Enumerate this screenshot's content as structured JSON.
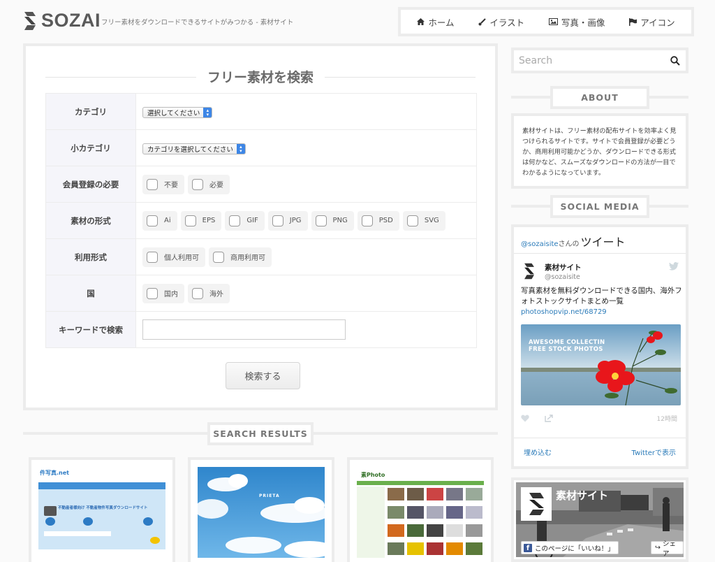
{
  "header": {
    "logo_text": "SOZAI",
    "tagline": "フリー素材をダウンロードできるサイトがみつかる - 素材サイト",
    "nav": [
      {
        "label": "ホーム",
        "icon": "home-icon"
      },
      {
        "label": "イラスト",
        "icon": "brush-icon"
      },
      {
        "label": "写真・画像",
        "icon": "picture-icon"
      },
      {
        "label": "アイコン",
        "icon": "flag-icon"
      }
    ]
  },
  "search_panel": {
    "title": "フリー素材を検索",
    "rows": {
      "category": {
        "label": "カテゴリ",
        "select": "選択してください"
      },
      "subcategory": {
        "label": "小カテゴリ",
        "select": "カテゴリを選択してください"
      },
      "registration": {
        "label": "会員登録の必要",
        "options": [
          "不要",
          "必要"
        ]
      },
      "format": {
        "label": "素材の形式",
        "options": [
          "Ai",
          "EPS",
          "GIF",
          "JPG",
          "PNG",
          "PSD",
          "SVG"
        ]
      },
      "usage": {
        "label": "利用形式",
        "options": [
          "個人利用可",
          "商用利用可"
        ]
      },
      "country": {
        "label": "国",
        "options": [
          "国内",
          "海外"
        ]
      },
      "keyword": {
        "label": "キーワードで検索",
        "value": ""
      }
    },
    "button": "検索する"
  },
  "results": {
    "heading": "SEARCH RESULTS",
    "cards": [
      {
        "title_text": "件写真.net",
        "headline": "不動産者様向け 不動産物件写真ダウンロードサイト"
      },
      {
        "title_text": "PRIETA"
      },
      {
        "title_text": "素Photo"
      }
    ]
  },
  "sidebar": {
    "search_placeholder": "Search",
    "about_heading": "ABOUT",
    "about_text": "素材サイトは、フリー素材の配布サイトを効率よく見つけられるサイトです。サイトで会員登録が必要どうか、商用利用可能かどうか、ダウンロードできる形式は何かなど、スムーズなダウンロードの方法が一目でわかるようになっています。",
    "social_heading": "SOCIAL MEDIA",
    "twitter": {
      "handle": "@sozaisite",
      "san": "さんの",
      "tweet_label": "ツイート",
      "account_name": "素材サイト",
      "account_user": "@sozaisite",
      "text": "写真素材を無料ダウンロードできる国内、海外フォトストックサイトまとめ一覧",
      "link": "photoshopvip.net/68729",
      "image_line1": "AWESOME COLLECTIN",
      "image_line2": "FREE STOCK PHOTOS",
      "time": "12時間",
      "embed": "埋め込む",
      "view": "Twitterで表示"
    },
    "facebook": {
      "page_name": "素材サイト",
      "like": "このページに「いいね！」",
      "share": "シェア"
    }
  }
}
